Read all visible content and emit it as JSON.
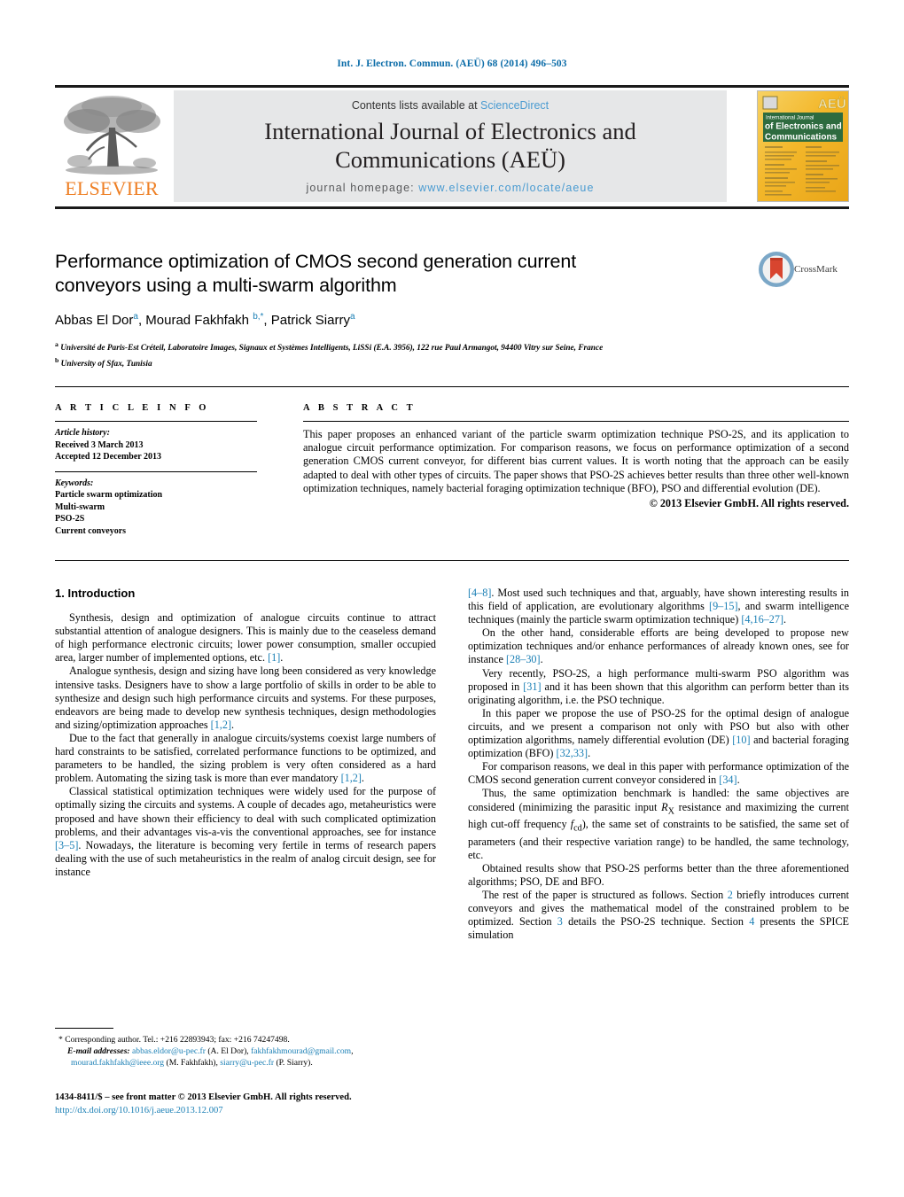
{
  "running_head": "Int. J. Electron. Commun. (AEÜ) 68 (2014) 496–503",
  "masthead": {
    "contents_prefix": "Contents lists available at ",
    "sciencedirect": "ScienceDirect",
    "journal_title_line1": "International Journal of Electronics and",
    "journal_title_line2": "Communications (AEÜ)",
    "homepage_label": "journal homepage: ",
    "homepage_url": "www.elsevier.com/locate/aeue",
    "publisher_wordmark": "ELSEVIER",
    "publisher_color": "#ee7f24",
    "band_color": "#e6e7e8",
    "cover": {
      "kicker": "International Journal",
      "line1": "of Electronics and",
      "line2": "Communications",
      "badge": "AEÜ",
      "cover_color": "#f5bc2e",
      "band_color": "#2e6b3f"
    }
  },
  "title": {
    "line1": "Performance optimization of CMOS second generation current",
    "line2": "conveyors using a multi-swarm algorithm"
  },
  "authors": [
    {
      "name": "Abbas El Dor",
      "marks": "a"
    },
    {
      "name": "Mourad Fakhfakh",
      "marks": "b,*"
    },
    {
      "name": "Patrick Siarry",
      "marks": "a"
    }
  ],
  "affiliations": [
    {
      "mark": "a",
      "text": "Université de Paris-Est Créteil, Laboratoire Images, Signaux et Systèmes Intelligents, LiSSi (E.A. 3956), 122 rue Paul Armangot, 94400 Vitry sur Seine, France"
    },
    {
      "mark": "b",
      "text": "University of Sfax, Tunisia"
    }
  ],
  "crossmark": {
    "label": "CrossMark",
    "ring_color": "#7ba7c7",
    "ribbon_color": "#d8452f"
  },
  "info": {
    "heading": "A R T I C L E   I N F O",
    "history_label": "Article history:",
    "history": [
      "Received 3 March 2013",
      "Accepted 12 December 2013"
    ],
    "keywords_label": "Keywords:",
    "keywords": [
      "Particle swarm optimization",
      "Multi-swarm",
      "PSO-2S",
      "Current conveyors"
    ]
  },
  "abstract": {
    "heading": "A B S T R A C T",
    "body": "This paper proposes an enhanced variant of the particle swarm optimization technique PSO-2S, and its application to analogue circuit performance optimization. For comparison reasons, we focus on performance optimization of a second generation CMOS current conveyor, for different bias current values. It is worth noting that the approach can be easily adapted to deal with other types of circuits. The paper shows that PSO-2S achieves better results than three other well-known optimization techniques, namely bacterial foraging optimization technique (BFO), PSO and differential evolution (DE).",
    "copyright": "© 2013 Elsevier GmbH. All rights reserved."
  },
  "body": {
    "section1_heading": "1.  Introduction",
    "left_paragraphs": [
      "Synthesis, design and optimization of analogue circuits continue to attract substantial attention of analogue designers. This is mainly due to the ceaseless demand of high performance electronic circuits; lower power consumption, smaller occupied area, larger number of implemented options, etc. [1].",
      "Analogue synthesis, design and sizing have long been considered as very knowledge intensive tasks. Designers have to show a large portfolio of skills in order to be able to synthesize and design such high performance circuits and systems. For these purposes, endeavors are being made to develop new synthesis techniques, design methodologies and sizing/optimization approaches [1,2].",
      "Due to the fact that generally in analogue circuits/systems coexist large numbers of hard constraints to be satisfied, correlated performance functions to be optimized, and parameters to be handled, the sizing problem is very often considered as a hard problem. Automating the sizing task is more than ever mandatory [1,2].",
      "Classical statistical optimization techniques were widely used for the purpose of optimally sizing the circuits and systems. A couple of decades ago, metaheuristics were proposed and have shown their efficiency to deal with such complicated optimization problems, and their advantages vis-a-vis the conventional approaches, see for instance [3–5]. Nowadays, the literature is becoming very fertile in terms of research papers dealing with the use of such metaheuristics in the realm of analog circuit design, see for instance"
    ],
    "right_paragraphs": [
      "[4–8]. Most used such techniques and that, arguably, have shown interesting results in this field of application, are evolutionary algorithms [9–15], and swarm intelligence techniques (mainly the particle swarm optimization technique) [4,16–27].",
      "On the other hand, considerable efforts are being developed to propose new optimization techniques and/or enhance performances of already known ones, see for instance [28–30].",
      "Very recently, PSO-2S, a high performance multi-swarm PSO algorithm was proposed in [31] and it has been shown that this algorithm can perform better than its originating algorithm, i.e. the PSO technique.",
      "In this paper we propose the use of PSO-2S for the optimal design of analogue circuits, and we present a comparison not only with PSO but also with other optimization algorithms, namely differential evolution (DE) [10] and bacterial foraging optimization (BFO) [32,33].",
      "For comparison reasons, we deal in this paper with performance optimization of the CMOS second generation current conveyor considered in [34].",
      "Thus, the same optimization benchmark is handled: the same objectives are considered (minimizing the parasitic input RX resistance and maximizing the current high cut-off frequency fcd), the same set of constraints to be satisfied, the same set of parameters (and their respective variation range) to be handled, the same technology, etc.",
      "Obtained results show that PSO-2S performs better than the three aforementioned algorithms; PSO, DE and BFO.",
      "The rest of the paper is structured as follows. Section 2 briefly introduces current conveyors and gives the mathematical model of the constrained problem to be optimized. Section 3 details the PSO-2S technique. Section 4 presents the SPICE simulation"
    ]
  },
  "footnote": {
    "corresponding": "*  Corresponding author. Tel.: +216 22893943; fax: +216 74247498.",
    "email_label": "E-mail addresses:",
    "emails": [
      {
        "address": "abbas.eldor@u-pec.fr",
        "owner": "(A. El Dor)"
      },
      {
        "address": "fakhfakhmourad@gmail.com",
        "owner": ""
      },
      {
        "address": "mourad.fakhfakh@ieee.org",
        "owner": "(M. Fakhfakh)"
      },
      {
        "address": "siarry@u-pec.fr",
        "owner": "(P. Siarry)."
      }
    ]
  },
  "imprint": {
    "line1": "1434-8411/$ – see front matter © 2013 Elsevier GmbH. All rights reserved.",
    "doi": "http://dx.doi.org/10.1016/j.aeue.2013.12.007"
  }
}
